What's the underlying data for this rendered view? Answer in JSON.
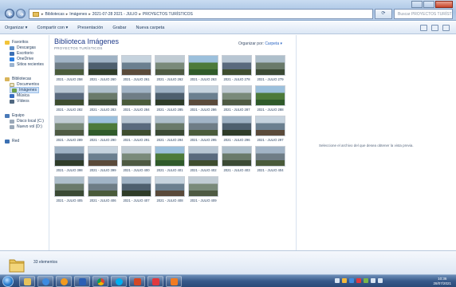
{
  "window": {
    "breadcrumb": [
      "Bibliotecas",
      "Imágenes",
      "2021-07-28 2021 - JULIO",
      "PROYECTOS TURÍSTICOS"
    ],
    "search_placeholder": "Buscar PROYECTOS TURÍSTICOS"
  },
  "toolbar": {
    "organize": "Organizar ▾",
    "share": "Compartir con ▾",
    "slideshow": "Presentación",
    "burn": "Grabar",
    "new_folder": "Nueva carpeta"
  },
  "nav": {
    "favorites": "Favoritos",
    "downloads": "Descargas",
    "desktop": "Escritorio",
    "onedrive": "OneDrive",
    "recent": "Sitios recientes",
    "libraries": "Bibliotecas",
    "documents": "Documentos",
    "images": "Imágenes",
    "music": "Música",
    "videos": "Vídeos",
    "computer": "Equipo",
    "local_disk": "Disco local (C:)",
    "new_volume": "Nuevo vol (D:)",
    "network": "Red"
  },
  "content": {
    "title": "Biblioteca Imágenes",
    "subtitle": "PROYECTOS TURÍSTICOS",
    "arrange_label": "Organizar por:",
    "arrange_value": "Carpeta ▾"
  },
  "thumbnails": [
    "2021 - JULIO 258",
    "2021 - JULIO 260",
    "2021 - JULIO 261",
    "2021 - JULIO 262",
    "2021 - JULIO 263",
    "2021 - JULIO 278",
    "2021 - JULIO 279",
    "2021 - JULIO 282",
    "2021 - JULIO 283",
    "2021 - JULIO 284",
    "2021 - JULIO 285",
    "2021 - JULIO 286",
    "2021 - JULIO 287",
    "2021 - JULIO 288",
    "2021 - JULIO 289",
    "2021 - JULIO 290",
    "2021 - JULIO 291",
    "2021 - JULIO 294",
    "2021 - JULIO 295",
    "2021 - JULIO 296",
    "2021 - JULIO 297",
    "2021 - JULIO 398",
    "2021 - JULIO 399",
    "2021 - JULIO 400",
    "2021 - JULIO 401",
    "2021 - JULIO 402",
    "2021 - JULIO 403",
    "2021 - JULIO 404",
    "2021 - JULIO 405",
    "2021 - JULIO 406",
    "2021 - JULIO 407",
    "2021 - JULIO 408",
    "2021 - JULIO 409"
  ],
  "preview": {
    "message": "Seleccione el archivo del que desea obtener la vista previa."
  },
  "details": {
    "count": "33 elementos"
  },
  "taskbar": {
    "time": "10:36",
    "date": "28/07/2021"
  }
}
